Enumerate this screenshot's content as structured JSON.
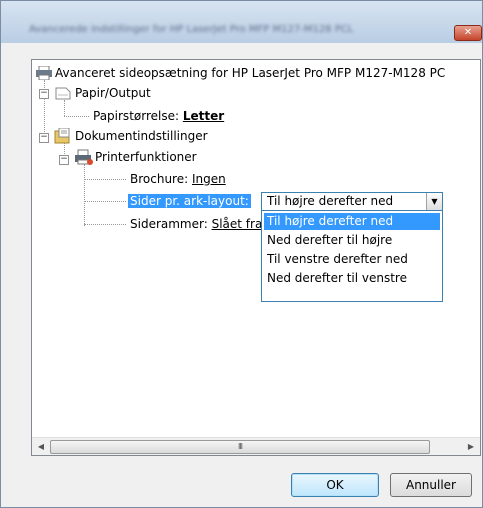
{
  "window": {
    "title": "Avancerede indstillinger for HP LaserJet Pro MFP M127-M128 PCL",
    "close_glyph": "✕"
  },
  "tree": {
    "root": "Avanceret sideopsætning for HP LaserJet Pro MFP M127-M128 PC",
    "paper_output": "Papir/Output",
    "paper_size_label": "Papirstørrelse:",
    "paper_size_value": "Letter",
    "document_options": "Dokumentindstillinger",
    "printer_features": "Printerfunktioner",
    "brochure_label": "Brochure:",
    "brochure_value": "Ingen",
    "pages_per_sheet_label": "Sider pr. ark-layout:",
    "page_borders_label": "Siderammer:",
    "page_borders_value": "Slået fra"
  },
  "combo": {
    "selected": "Til højre derefter ned",
    "options": [
      "Til højre derefter ned",
      "Ned derefter til højre",
      "Til venstre derefter ned",
      "Ned derefter til venstre"
    ]
  },
  "scroll": {
    "left": "◀",
    "right": "▶",
    "thumb_grip": "III"
  },
  "buttons": {
    "ok": "OK",
    "cancel": "Annuller"
  },
  "colors": {
    "selection": "#3399ff",
    "focus_border": "#3c7fb1"
  }
}
